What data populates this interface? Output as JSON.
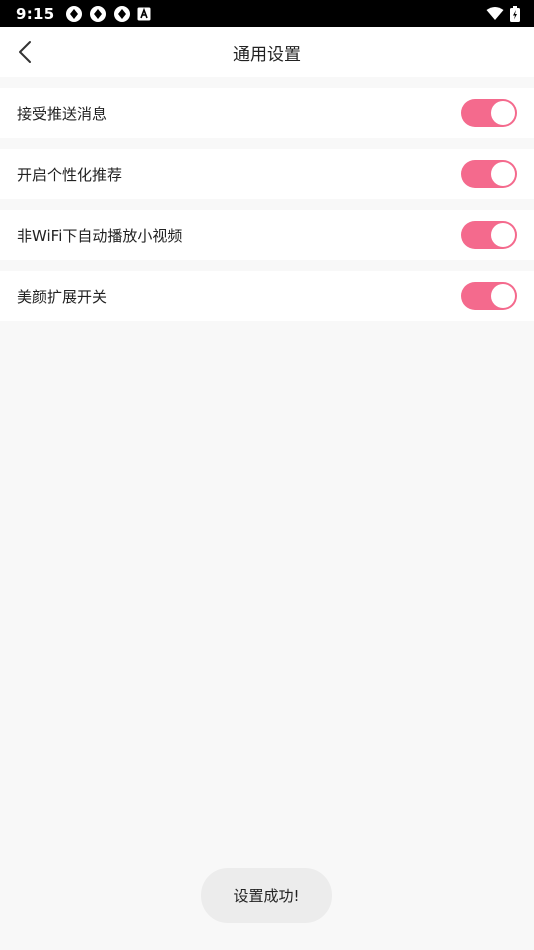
{
  "status_bar": {
    "time": "9:15",
    "notification_icons": [
      "aperture-icon",
      "aperture-icon",
      "aperture-icon",
      "font-a-icon"
    ],
    "right_icons": [
      "wifi-icon",
      "battery-charging-icon"
    ]
  },
  "app_bar": {
    "title": "通用设置",
    "back_icon": "chevron-left-icon"
  },
  "settings": [
    {
      "label": "接受推送消息",
      "enabled": true
    },
    {
      "label": "开启个性化推荐",
      "enabled": true
    },
    {
      "label": "非WiFi下自动播放小视频",
      "enabled": true
    },
    {
      "label": "美颜扩展开关",
      "enabled": true
    }
  ],
  "toast": {
    "message": "设置成功!"
  },
  "colors": {
    "toggle_on": "#f46a8d",
    "background": "#f8f8f8",
    "surface": "#ffffff"
  }
}
